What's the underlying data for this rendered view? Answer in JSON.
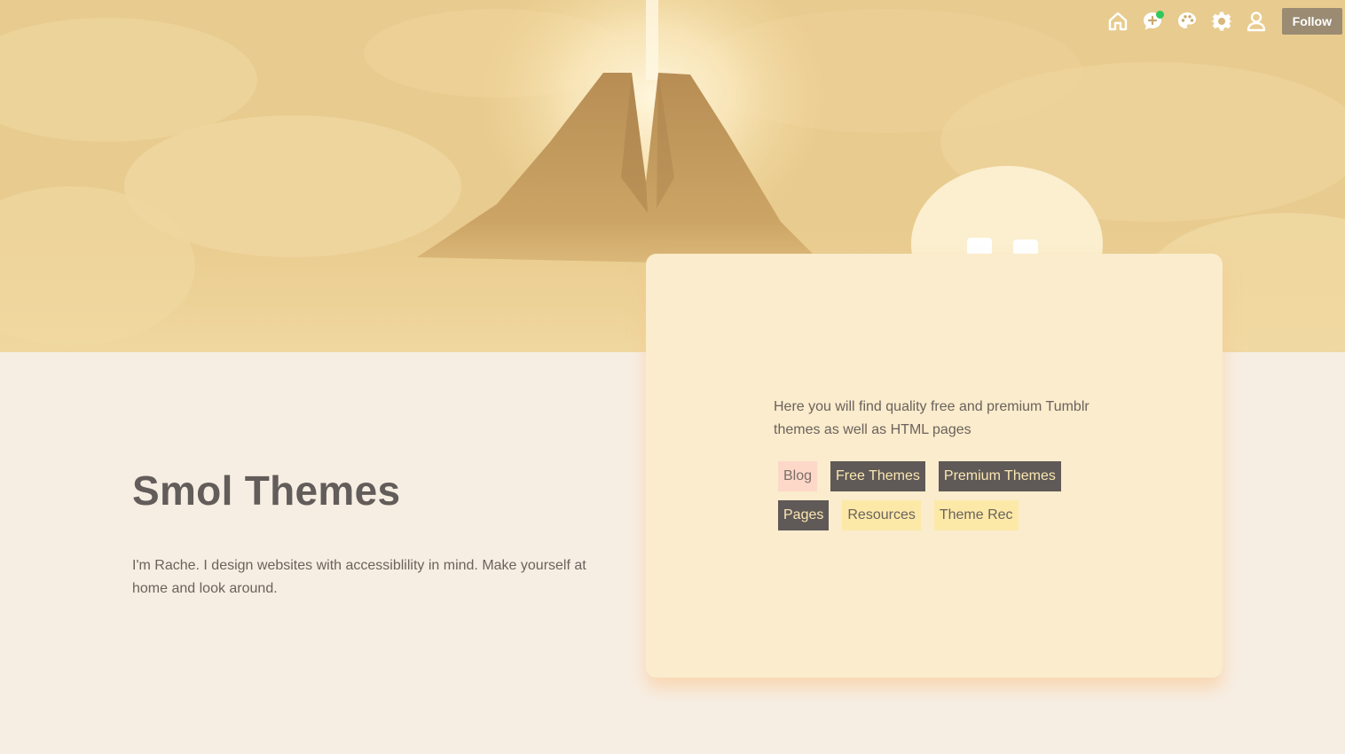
{
  "header": {
    "icons": [
      {
        "name": "home-icon"
      },
      {
        "name": "new-post-icon",
        "has_notification": true
      },
      {
        "name": "palette-icon"
      },
      {
        "name": "gear-icon"
      },
      {
        "name": "user-icon"
      }
    ],
    "follow_label": "Follow"
  },
  "intro": {
    "title": "Smol Themes",
    "description": "I'm Rache. I design websites with accessiblility in mind. Make yourself at home and look around."
  },
  "card": {
    "text": "Here you will find quality free and premium Tumblr themes as well as HTML pages",
    "links": [
      {
        "label": "Blog",
        "style": "pink"
      },
      {
        "label": "Free Themes",
        "style": "dark"
      },
      {
        "label": "Premium Themes",
        "style": "dark"
      },
      {
        "label": "Pages",
        "style": "dark"
      },
      {
        "label": "Resources",
        "style": "yellow"
      },
      {
        "label": "Theme Rec",
        "style": "yellow"
      }
    ]
  },
  "colors": {
    "page_bg": "#f7eee3",
    "banner": "#e8cb8e",
    "card_bg": "#faeccc",
    "follow_bg": "#9a8b72",
    "notification": "#2fc85a",
    "tag_pink": "#fdd8c8",
    "tag_dark": "#5f5957",
    "tag_yellow": "#fce9a8"
  }
}
